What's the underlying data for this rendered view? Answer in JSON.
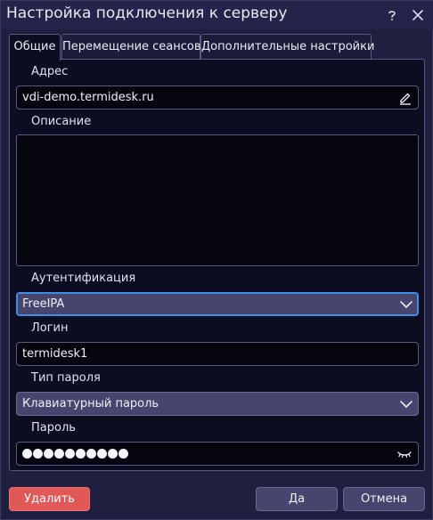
{
  "window": {
    "title": "Настройка подключения к серверу"
  },
  "tabs": [
    {
      "label": "Общие",
      "active": true
    },
    {
      "label": "Перемещение сеансов",
      "active": false
    },
    {
      "label": "Дополнительные настройки",
      "active": false
    }
  ],
  "form": {
    "address": {
      "label": "Адрес",
      "value": "vdi-demo.termidesk.ru"
    },
    "description": {
      "label": "Описание",
      "value": ""
    },
    "auth": {
      "label": "Аутентификация",
      "selected": "FreeIPA"
    },
    "login": {
      "label": "Логин",
      "value": "termidesk1"
    },
    "password_type": {
      "label": "Тип пароля",
      "selected": "Клавиатурный пароль"
    },
    "password": {
      "label": "Пароль",
      "masked_length": 10
    }
  },
  "buttons": {
    "delete": "Удалить",
    "ok": "Да",
    "cancel": "Отмена"
  },
  "colors": {
    "background": "#1f1f3f",
    "panel": "#0d0d22",
    "accent_focus": "#3c8ee6",
    "danger": "#e25757",
    "button": "#45456e"
  },
  "icons": {
    "address_field": "pencil-clear-icon",
    "password_field": "eye-closed-icon",
    "dropdown": "chevron-down-icon",
    "window_help": "question-icon",
    "window_close": "close-icon"
  }
}
